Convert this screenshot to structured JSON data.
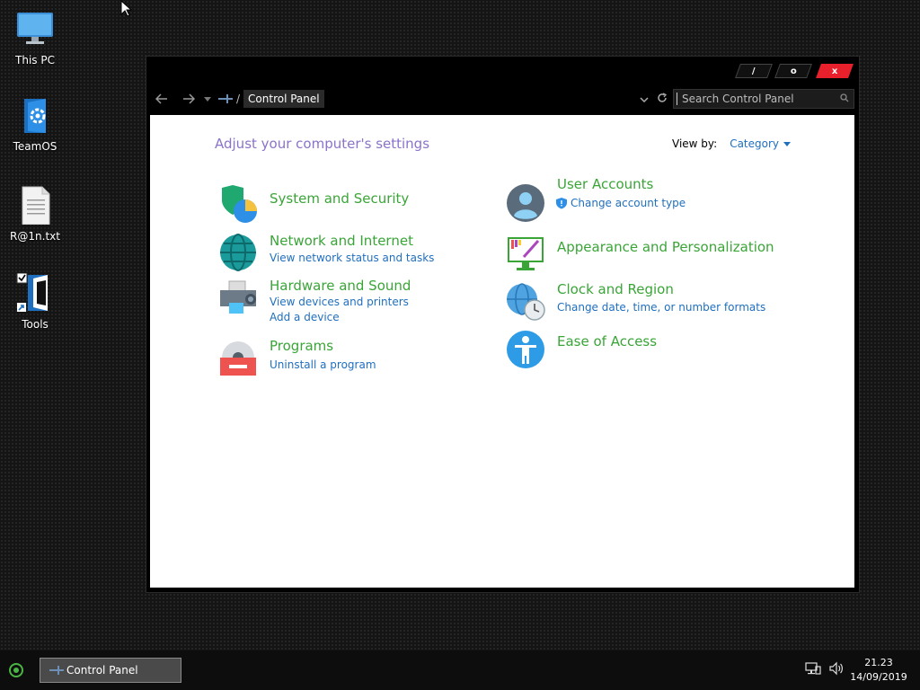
{
  "desktop": {
    "icons": [
      {
        "label": "This PC",
        "icon": "monitor-icon"
      },
      {
        "label": "TeamOS",
        "icon": "teamos-book-icon"
      },
      {
        "label": "R@1n.txt",
        "icon": "text-file-icon"
      },
      {
        "label": "Tools",
        "icon": "folder-shortcut-icon"
      }
    ]
  },
  "window": {
    "title_buttons": {
      "minimize": "/",
      "maximize": "o",
      "close": "x"
    },
    "address": {
      "back_icon": "arrow-left-icon",
      "forward_icon": "arrow-right-icon",
      "recent_icon": "chevron-down-icon",
      "breadcrumb_separator": "/",
      "breadcrumb": "Control Panel",
      "search_placeholder": "Search Control Panel"
    },
    "content": {
      "heading": "Adjust your computer's settings",
      "view_by_label": "View by:",
      "view_by_value": "Category",
      "categories_left": [
        {
          "title": "System and Security",
          "links": []
        },
        {
          "title": "Network and Internet",
          "links": [
            "View network status and tasks"
          ]
        },
        {
          "title": "Hardware and Sound",
          "links": [
            "View devices and printers",
            "Add a device"
          ]
        },
        {
          "title": "Programs",
          "links": [
            "Uninstall a program"
          ]
        }
      ],
      "categories_right": [
        {
          "title": "User Accounts",
          "links": [
            "Change account type"
          ]
        },
        {
          "title": "Appearance and Personalization",
          "links": []
        },
        {
          "title": "Clock and Region",
          "links": [
            "Change date, time, or number formats"
          ]
        },
        {
          "title": "Ease of Access",
          "links": []
        }
      ]
    }
  },
  "taskbar": {
    "task_label": "Control Panel",
    "time": "21.23",
    "date": "14/09/2019"
  },
  "colors": {
    "category_title": "#3aa537",
    "link": "#1f6fbf",
    "heading": "#8a73c9",
    "close_button": "#e8202c"
  }
}
